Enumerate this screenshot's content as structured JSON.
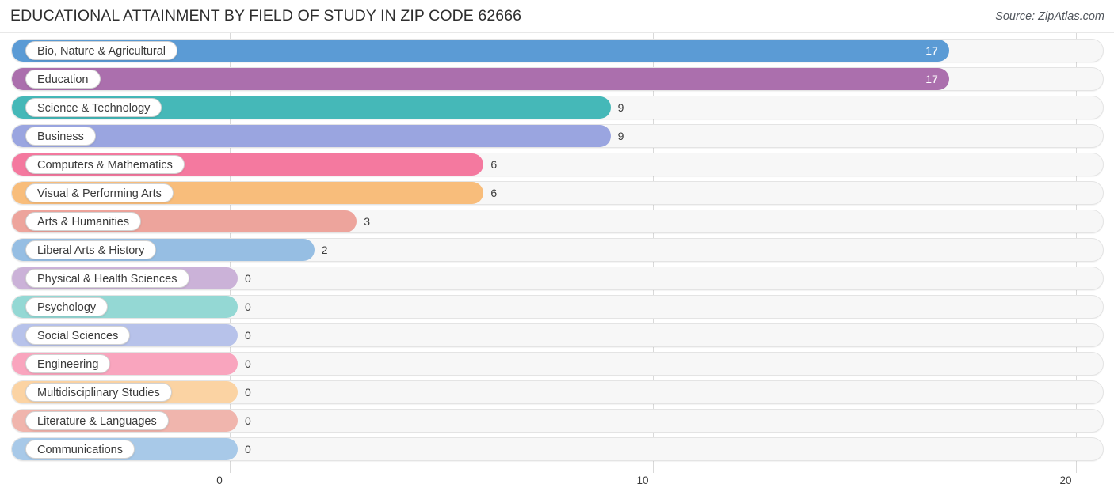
{
  "header": {
    "title": "EDUCATIONAL ATTAINMENT BY FIELD OF STUDY IN ZIP CODE 62666",
    "source": "Source: ZipAtlas.com"
  },
  "chart_data": {
    "type": "bar",
    "orientation": "horizontal",
    "title": "EDUCATIONAL ATTAINMENT BY FIELD OF STUDY IN ZIP CODE 62666",
    "subtitle": "",
    "xlabel": "",
    "ylabel": "",
    "xlim": [
      0,
      20
    ],
    "xticks": [
      0,
      10,
      20
    ],
    "xtick_labels": [
      "0",
      "10",
      "20"
    ],
    "grid": true,
    "legend": false,
    "categories": [
      "Bio, Nature & Agricultural",
      "Education",
      "Science & Technology",
      "Business",
      "Computers & Mathematics",
      "Visual & Performing Arts",
      "Arts & Humanities",
      "Liberal Arts & History",
      "Physical & Health Sciences",
      "Psychology",
      "Social Sciences",
      "Engineering",
      "Multidisciplinary Studies",
      "Literature & Languages",
      "Communications"
    ],
    "values": [
      17,
      17,
      9,
      9,
      6,
      6,
      3,
      2,
      0,
      0,
      0,
      0,
      0,
      0,
      0
    ],
    "value_labels": [
      "17",
      "17",
      "9",
      "9",
      "6",
      "6",
      "3",
      "2",
      "0",
      "0",
      "0",
      "0",
      "0",
      "0",
      "0"
    ],
    "colors": [
      "#5b9bd5",
      "#ab6fad",
      "#45b8b8",
      "#9aa5e0",
      "#f4799f",
      "#f8bd7b",
      "#eda49c",
      "#96bee3",
      "#cbb2d8",
      "#94d8d4",
      "#b7c2ea",
      "#f9a5be",
      "#fbd3a3",
      "#f0b5ad",
      "#a8c9e8"
    ]
  }
}
